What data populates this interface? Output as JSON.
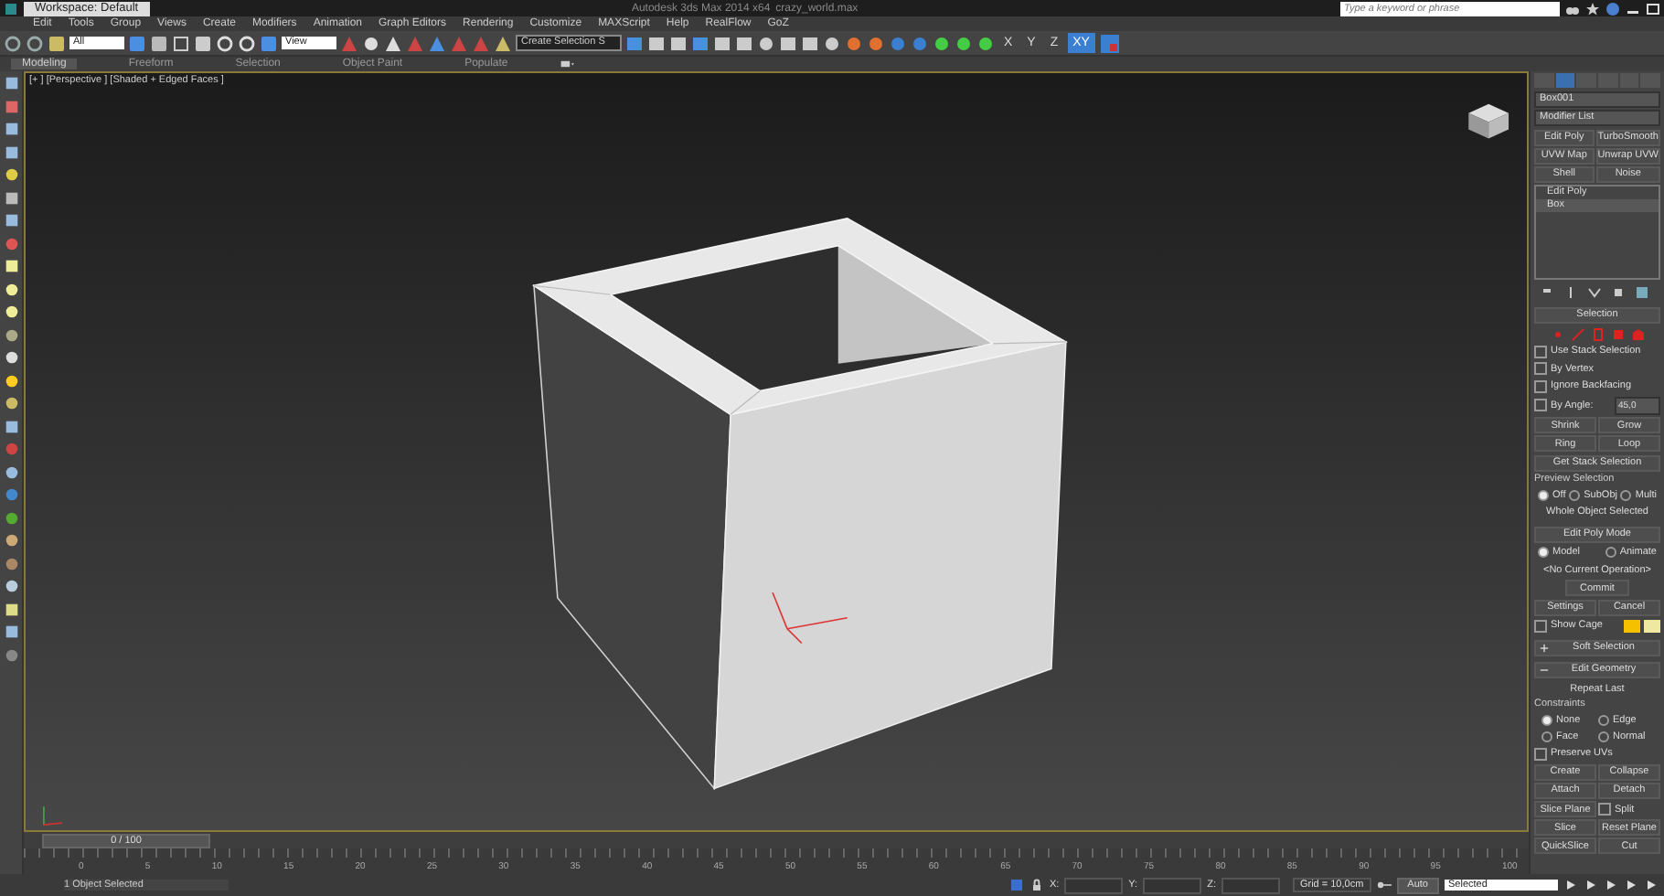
{
  "title_bar": {
    "workspace": "Workspace: Default",
    "title": "Autodesk 3ds Max 2014 x64",
    "file": "crazy_world.max",
    "search": {
      "placeholder": "Type a keyword or phrase"
    }
  },
  "menu": [
    "Edit",
    "Tools",
    "Group",
    "Views",
    "Create",
    "Modifiers",
    "Animation",
    "Graph Editors",
    "Rendering",
    "Customize",
    "MAXScript",
    "Help",
    "RealFlow",
    "GoZ"
  ],
  "toolbar": {
    "selection_filter": "All",
    "reference_coord": "View",
    "named_selection": "Create Selection S",
    "axis_buttons": [
      {
        "label": "X",
        "selected": false
      },
      {
        "label": "Y",
        "selected": false
      },
      {
        "label": "Z",
        "selected": false
      },
      {
        "label": "XY",
        "selected": true
      }
    ]
  },
  "ribbon_tabs": [
    {
      "label": "Modeling",
      "selected": true
    },
    {
      "label": "Freeform",
      "selected": false
    },
    {
      "label": "Selection",
      "selected": false
    },
    {
      "label": "Object Paint",
      "selected": false
    },
    {
      "label": "Populate",
      "selected": false
    }
  ],
  "viewport": {
    "label": "[+ ] [Perspective ] [Shaded + Edged Faces ]"
  },
  "command_panel": {
    "tabs": [
      {
        "selected": false
      },
      {
        "selected": true
      },
      {
        "selected": false
      },
      {
        "selected": false
      },
      {
        "selected": false
      },
      {
        "selected": false
      }
    ],
    "object_name": "Box001",
    "modifier_list": "Modifier List",
    "modifier_buttons": [
      "Edit Poly",
      "TurboSmooth",
      "UVW Map",
      "Unwrap UVW",
      "Shell",
      "Noise"
    ],
    "stack": [
      {
        "label": "Edit Poly",
        "selected": false
      },
      {
        "label": "Box",
        "selected": true
      }
    ],
    "selection": {
      "title": "Selection",
      "checkboxes": [
        {
          "label": "Use Stack Selection",
          "checked": false
        },
        {
          "label": "By Vertex",
          "checked": false
        },
        {
          "label": "Ignore Backfacing",
          "checked": false
        },
        {
          "label": "By Angle:",
          "checked": false
        }
      ],
      "angle": "45,0",
      "buttons": [
        "Shrink",
        "Grow",
        "Ring",
        "Loop"
      ],
      "get_stack": "Get Stack Selection"
    },
    "preview": {
      "title": "Preview Selection",
      "options": [
        {
          "label": "Off",
          "selected": true
        },
        {
          "label": "SubObj",
          "selected": false
        },
        {
          "label": "Multi",
          "selected": false
        }
      ],
      "status": "Whole Object Selected"
    },
    "edit_poly_mode": {
      "title": "Edit Poly Mode",
      "modes": [
        {
          "label": "Model",
          "selected": true
        },
        {
          "label": "Animate",
          "selected": false
        }
      ],
      "operation": "<No Current Operation>",
      "commit": "Commit",
      "settings": "Settings",
      "cancel": "Cancel",
      "show_cage": {
        "label": "Show Cage",
        "checked": false
      }
    },
    "soft_selection": {
      "title": "Soft Selection",
      "expanded": false
    },
    "edit_geometry": {
      "title": "Edit Geometry",
      "expanded": true,
      "repeat_last": "Repeat Last",
      "constraints_title": "Constraints",
      "constraints": [
        {
          "label": "None",
          "selected": true
        },
        {
          "label": "Edge",
          "selected": false
        },
        {
          "label": "Face",
          "selected": false
        },
        {
          "label": "Normal",
          "selected": false
        }
      ],
      "preserve_uvs": {
        "label": "Preserve UVs",
        "checked": false
      },
      "buttons": [
        "Create",
        "Collapse",
        "Attach",
        "Detach"
      ],
      "slice_plane": "Slice Plane",
      "split": {
        "label": "Split",
        "checked": false
      },
      "buttons2": [
        "Slice",
        "Reset Plane",
        "QuickSlice",
        "Cut"
      ]
    }
  },
  "timeline": {
    "frame": "0 / 100",
    "level": 0,
    "ticks": [
      "0",
      "5",
      "10",
      "15",
      "20",
      "25",
      "30",
      "35",
      "40",
      "45",
      "50",
      "55",
      "60",
      "65",
      "70",
      "75",
      "80",
      "85",
      "90",
      "95",
      "100"
    ]
  },
  "status_bar": {
    "message": "1 Object Selected",
    "coords": [
      "X:",
      "Y:",
      "Z:"
    ],
    "grid": "Grid = 10,0cm",
    "auto_key": "Auto",
    "key_filter": "Selected"
  }
}
